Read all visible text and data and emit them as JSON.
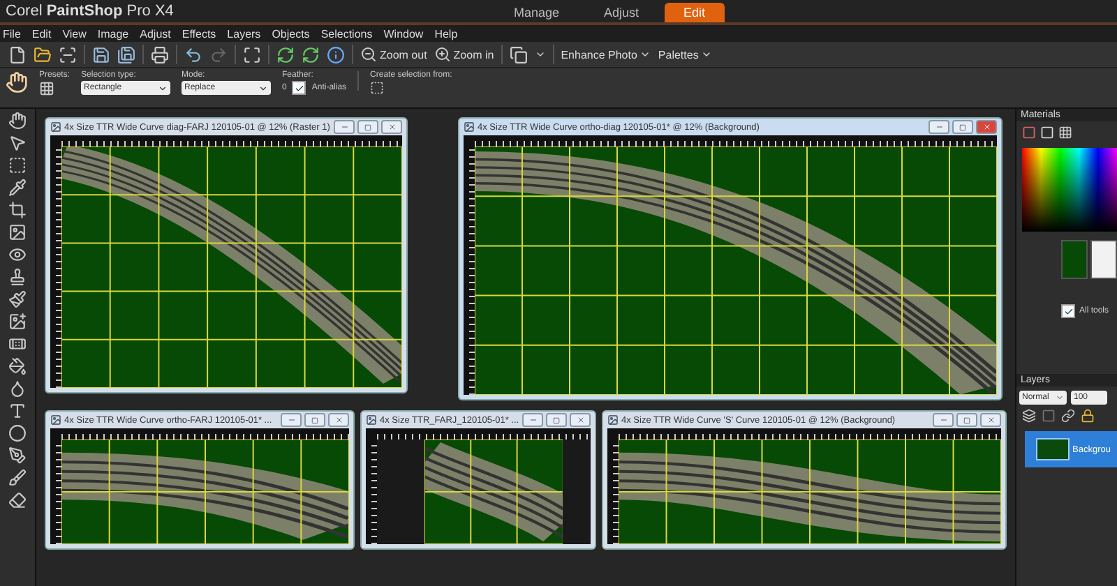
{
  "app": {
    "title": "Corel **PaintShop** Pro X4"
  },
  "tabs": [
    {
      "label": "Manage",
      "selected": false
    },
    {
      "label": "Adjust",
      "selected": false
    },
    {
      "label": "Edit",
      "selected": true
    }
  ],
  "menu": [
    "File",
    "Edit",
    "View",
    "Image",
    "Adjust",
    "Effects",
    "Layers",
    "Objects",
    "Selections",
    "Window",
    "Help"
  ],
  "toolbar": {
    "zoom_out": "Zoom out",
    "zoom_in": "Zoom in",
    "enhance": "Enhance Photo",
    "palettes": "Palettes"
  },
  "tool_options": {
    "presets_label": "Presets:",
    "selection_type_label": "Selection type:",
    "selection_type": "Rectangle",
    "mode_label": "Mode:",
    "mode": "Replace",
    "feather_label": "Feather:",
    "feather": "0",
    "anti_alias": {
      "label": "Anti-alias",
      "checked": true
    },
    "create_from_label": "Create selection from:"
  },
  "workspace": {
    "top_windows": [
      {
        "kind": "diag",
        "title": "4x Size TTR Wide Curve diag-FARJ 120105-01 @ 12% (Raster 1)",
        "active": false
      },
      {
        "kind": "ortho-diag",
        "title": "4x Size TTR Wide Curve ortho-diag 120105-01* @ 12% (Background)",
        "active": true
      }
    ],
    "bottom_windows": [
      {
        "kind": "ortho",
        "title": "4x Size TTR Wide Curve ortho-FARJ 120105-01* ...",
        "active": false
      },
      {
        "kind": "farj",
        "title": "4x Size TTR_FARJ_120105-01* ...",
        "active": false
      },
      {
        "kind": "s-curve",
        "title": "4x Size TTR Wide Curve 'S' Curve 120105-01 @ 12% (Background)",
        "active": false
      }
    ]
  },
  "materials": {
    "title": "Materials",
    "all_tools": {
      "label": "All tools",
      "checked": true
    }
  },
  "layers": {
    "title": "Layers",
    "blend_mode": "Normal",
    "opacity": "100",
    "items": [
      {
        "name": "Backgrou",
        "selected": true
      }
    ]
  }
}
